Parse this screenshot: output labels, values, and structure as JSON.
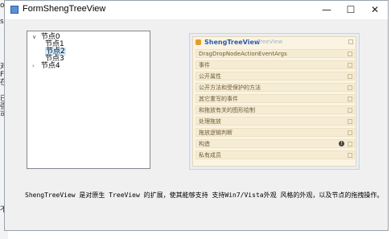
{
  "backdrop": {
    "fragments": [
      "or",
      "s:",
      "",
      "对",
      "F",
      "在",
      "",
      "已",
      "强",
      "可",
      "",
      "不"
    ]
  },
  "window": {
    "title": "FormShengTreeView",
    "controls": {
      "minimize": "—",
      "maximize": "☐",
      "close": "✕"
    }
  },
  "tree": {
    "nodes": [
      {
        "label": "节点0",
        "expander": "∨",
        "level": 0
      },
      {
        "label": "节点1",
        "expander": "",
        "level": 1
      },
      {
        "label": "节点2",
        "expander": "",
        "level": 1,
        "selected": true
      },
      {
        "label": "节点3",
        "expander": "",
        "level": 1
      },
      {
        "label": "节点4",
        "expander": "›",
        "level": 0
      }
    ]
  },
  "panel": {
    "name": "ShengTreeView",
    "class": "TreeView",
    "rows": [
      "DragDropNodeActionEventArgs",
      "事件",
      "公开属性",
      "公开方法和受保护的方法",
      "其它重写的事件",
      "和拖放有关的图形绘制",
      "处理拖放",
      "拖放逻辑判断",
      "构造",
      "私有成员"
    ]
  },
  "description": "ShengTreeView 是对原生 TreeView 的扩展，使其能够支持 支持Win7/Vista外观 风格的外观，以及节点的拖拽操作。"
}
